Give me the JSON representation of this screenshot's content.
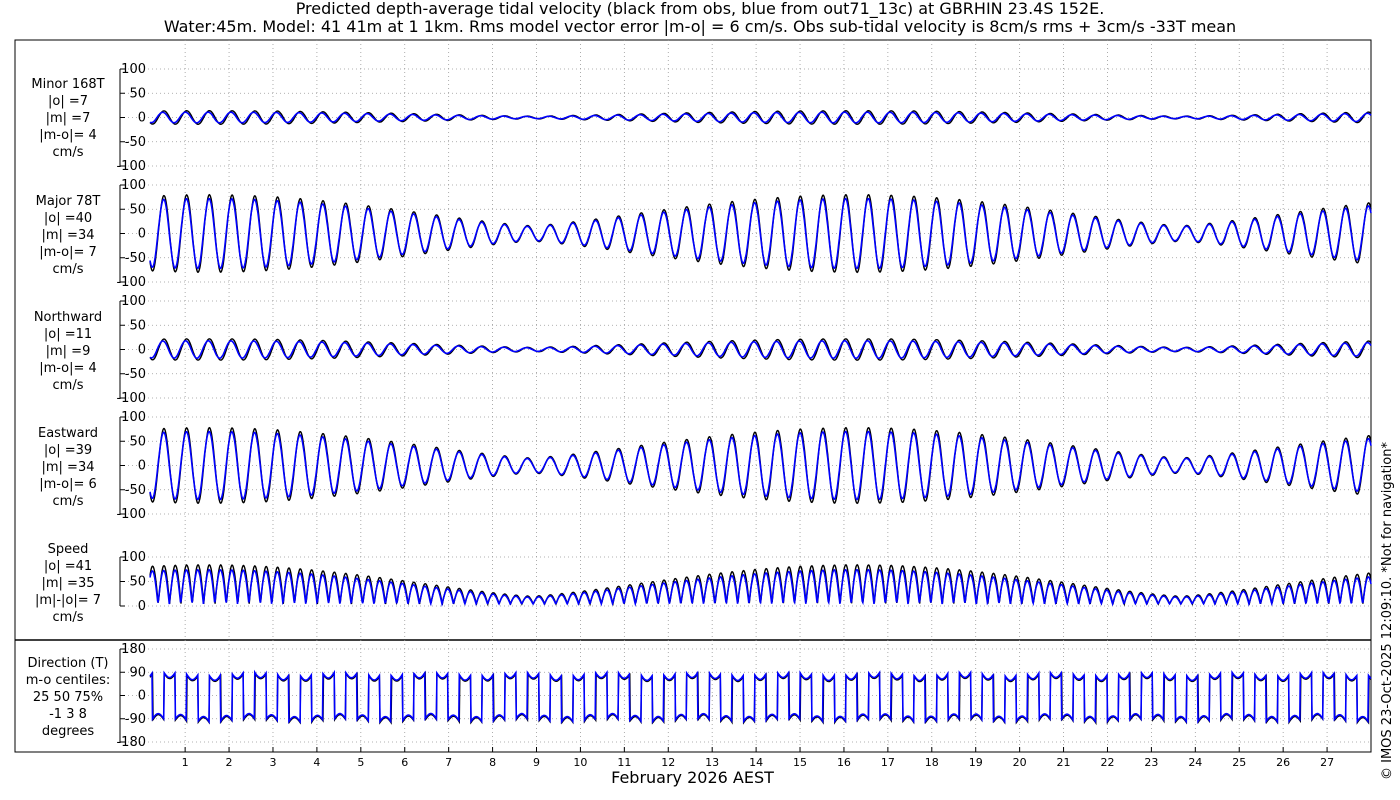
{
  "title": {
    "line1": "Predicted depth-average tidal velocity (black from obs, blue from out71_13c) at GBRHIN 23.4S 152E.",
    "line2": "Water:45m. Model: 41 41m at 1 1km. Rms model vector error |m-o| = 6 cm/s. Obs sub-tidal velocity is 8cm/s rms + 3cm/s -33T mean"
  },
  "footer_note": "© IMOS 23-Oct-2025 12:09:10. *Not for navigation*",
  "colors": {
    "obs": "#000000",
    "model": "#0000ff",
    "grid": "#999999"
  },
  "chart_data": {
    "type": "line",
    "xlabel": "February 2026 AEST",
    "x_ticks": [
      "1",
      "2",
      "3",
      "4",
      "5",
      "6",
      "7",
      "8",
      "9",
      "10",
      "11",
      "12",
      "13",
      "14",
      "15",
      "16",
      "17",
      "18",
      "19",
      "20",
      "21",
      "22",
      "23",
      "24",
      "25",
      "26",
      "27"
    ],
    "x_range_days": [
      0.2,
      28.0
    ],
    "panels": [
      {
        "key": "minor",
        "label_lines": [
          "Minor 168T",
          "|o| =7",
          "|m| =7",
          "|m-o|= 4",
          "cm/s"
        ],
        "yticks": [
          "100",
          "50",
          "0",
          "-50",
          "-100"
        ],
        "ylim": [
          -100,
          100
        ],
        "series": [
          {
            "name": "obs",
            "amplitude": 14,
            "phase": 0.0
          },
          {
            "name": "model",
            "amplitude": 11,
            "phase": 0.35
          }
        ]
      },
      {
        "key": "major",
        "label_lines": [
          "Major 78T",
          "|o| =40",
          "|m| =34",
          "|m-o|= 7",
          "cm/s"
        ],
        "yticks": [
          "100",
          "50",
          "0",
          "-50",
          "-100"
        ],
        "ylim": [
          -100,
          100
        ],
        "series": [
          {
            "name": "obs",
            "amplitude": 80,
            "phase": 0.0
          },
          {
            "name": "model",
            "amplitude": 72,
            "phase": 0.08
          }
        ]
      },
      {
        "key": "north",
        "label_lines": [
          "Northward",
          "|o| =11",
          "|m| =9",
          "|m-o|= 4",
          "cm/s"
        ],
        "yticks": [
          "100",
          "50",
          "0",
          "-50",
          "-100"
        ],
        "ylim": [
          -100,
          100
        ],
        "series": [
          {
            "name": "obs",
            "amplitude": 22,
            "phase": 0.0
          },
          {
            "name": "model",
            "amplitude": 18,
            "phase": 0.3
          }
        ]
      },
      {
        "key": "east",
        "label_lines": [
          "Eastward",
          "|o| =39",
          "|m| =34",
          "|m-o|= 6",
          "cm/s"
        ],
        "yticks": [
          "100",
          "50",
          "0",
          "-50",
          "-100"
        ],
        "ylim": [
          -100,
          100
        ],
        "series": [
          {
            "name": "obs",
            "amplitude": 78,
            "phase": 0.0
          },
          {
            "name": "model",
            "amplitude": 70,
            "phase": 0.08
          }
        ]
      },
      {
        "key": "speed",
        "label_lines": [
          "Speed",
          "|o| =41",
          "|m| =35",
          "|m|-|o|= 7",
          "cm/s"
        ],
        "yticks": [
          "100",
          "50",
          "0"
        ],
        "ylim": [
          0,
          100
        ],
        "series": [
          {
            "name": "obs",
            "amplitude": 80,
            "phase": 0.0
          },
          {
            "name": "model",
            "amplitude": 70,
            "phase": 0.08
          }
        ]
      },
      {
        "key": "direction",
        "label_lines": [
          "Direction (T)",
          "m-o centiles:",
          "25  50  75%",
          "-1  3  8",
          "degrees"
        ],
        "yticks": [
          "180",
          "90",
          "0",
          "-90",
          "-180"
        ],
        "ylim": [
          -180,
          180
        ],
        "series": [
          {
            "name": "obs"
          },
          {
            "name": "model"
          }
        ]
      }
    ]
  }
}
